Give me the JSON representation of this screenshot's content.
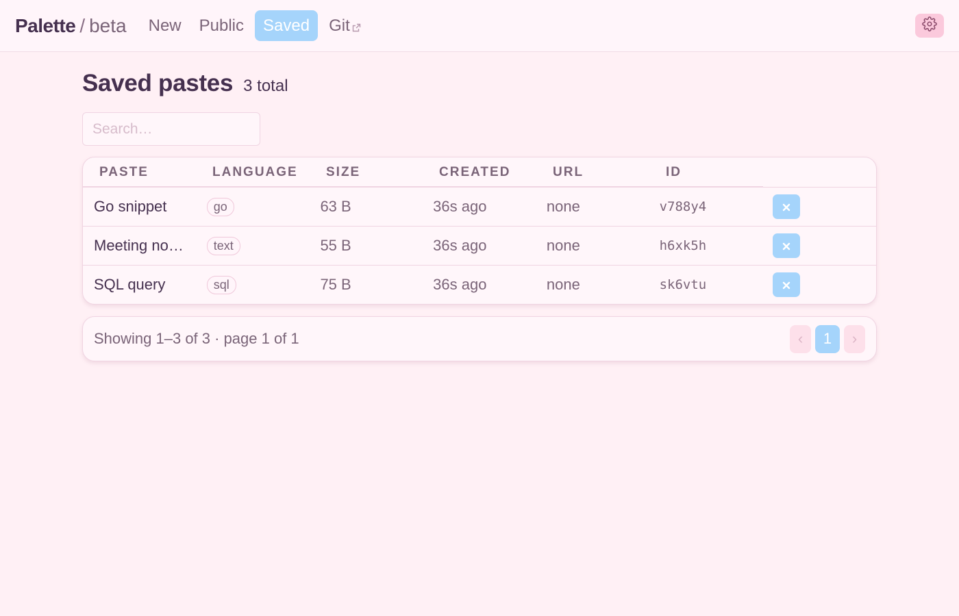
{
  "header": {
    "brand": "Palette",
    "separator": "/",
    "brand_sub": "beta",
    "nav": [
      {
        "label": "New"
      },
      {
        "label": "Public"
      },
      {
        "label": "Saved",
        "active": true
      },
      {
        "label": "Git"
      }
    ]
  },
  "page": {
    "title": "Saved pastes",
    "total": "3 total",
    "search_placeholder": "Search…"
  },
  "table": {
    "columns": [
      "PASTE",
      "LANGUAGE",
      "SIZE",
      "CREATED",
      "URL",
      "ID"
    ],
    "rows": [
      {
        "name": "Go snippet",
        "language": "go",
        "size": "63 B",
        "created": "36s ago",
        "url": "none",
        "id": "v788y4"
      },
      {
        "name": "Meeting no…",
        "language": "text",
        "size": "55 B",
        "created": "36s ago",
        "url": "none",
        "id": "h6xk5h"
      },
      {
        "name": "SQL query",
        "language": "sql",
        "size": "75 B",
        "created": "36s ago",
        "url": "none",
        "id": "sk6vtu"
      }
    ]
  },
  "footer": {
    "showing": "Showing 1–3 of 3 · page 1 of 1",
    "prev": "‹",
    "current_page": "1",
    "next": "›"
  },
  "colors": {
    "accent": "#a5d4fb",
    "background": "#fff0f5",
    "text": "#45304f",
    "muted": "#7a6478",
    "settings_bg": "#fbc9dc"
  }
}
